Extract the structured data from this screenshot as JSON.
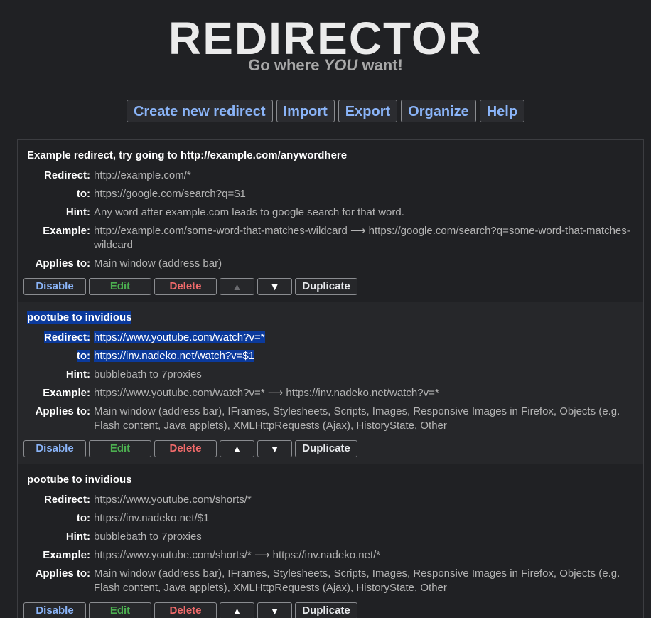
{
  "header": {
    "logo": "REDIRECTOR",
    "tagline_pre": "Go where ",
    "tagline_you": "YOU",
    "tagline_post": " want!"
  },
  "menu": {
    "create": "Create new redirect",
    "import": "Import",
    "export": "Export",
    "organize": "Organize",
    "help": "Help"
  },
  "labels": {
    "redirect": "Redirect:",
    "to": "to:",
    "hint": "Hint:",
    "example": "Example:",
    "applies": "Applies to:"
  },
  "buttons": {
    "disable": "Disable",
    "edit": "Edit",
    "delete": "Delete",
    "up": "▲",
    "down": "▼",
    "duplicate": "Duplicate"
  },
  "redirects": [
    {
      "title": "Example redirect, try going to http://example.com/anywordhere",
      "redirect": "http://example.com/*",
      "to": "https://google.com/search?q=$1",
      "hint": "Any word after example.com leads to google search for that word.",
      "example_from": "http://example.com/some-word-that-matches-wildcard",
      "example_arrow": "⟶",
      "example_to": "https://google.com/search?q=some-word-that-matches-wildcard",
      "applies": "Main window (address bar)"
    },
    {
      "title": "pootube to invidious",
      "redirect": "https://www.youtube.com/watch?v=*",
      "to": "https://inv.nadeko.net/watch?v=$1",
      "hint": "bubblebath to 7proxies",
      "example_from": "https://www.youtube.com/watch?v=*",
      "example_arrow": "⟶",
      "example_to": "https://inv.nadeko.net/watch?v=*",
      "applies": "Main window (address bar), IFrames, Stylesheets, Scripts, Images, Responsive Images in Firefox, Objects (e.g. Flash content, Java applets), XMLHttpRequests (Ajax), HistoryState, Other"
    },
    {
      "title": "pootube to invidious",
      "redirect": "https://www.youtube.com/shorts/*",
      "to": "https://inv.nadeko.net/$1",
      "hint": "bubblebath to 7proxies",
      "example_from": "https://www.youtube.com/shorts/*",
      "example_arrow": "⟶",
      "example_to": "https://inv.nadeko.net/*",
      "applies": "Main window (address bar), IFrames, Stylesheets, Scripts, Images, Responsive Images in Firefox, Objects (e.g. Flash content, Java applets), XMLHttpRequests (Ajax), HistoryState, Other"
    }
  ]
}
